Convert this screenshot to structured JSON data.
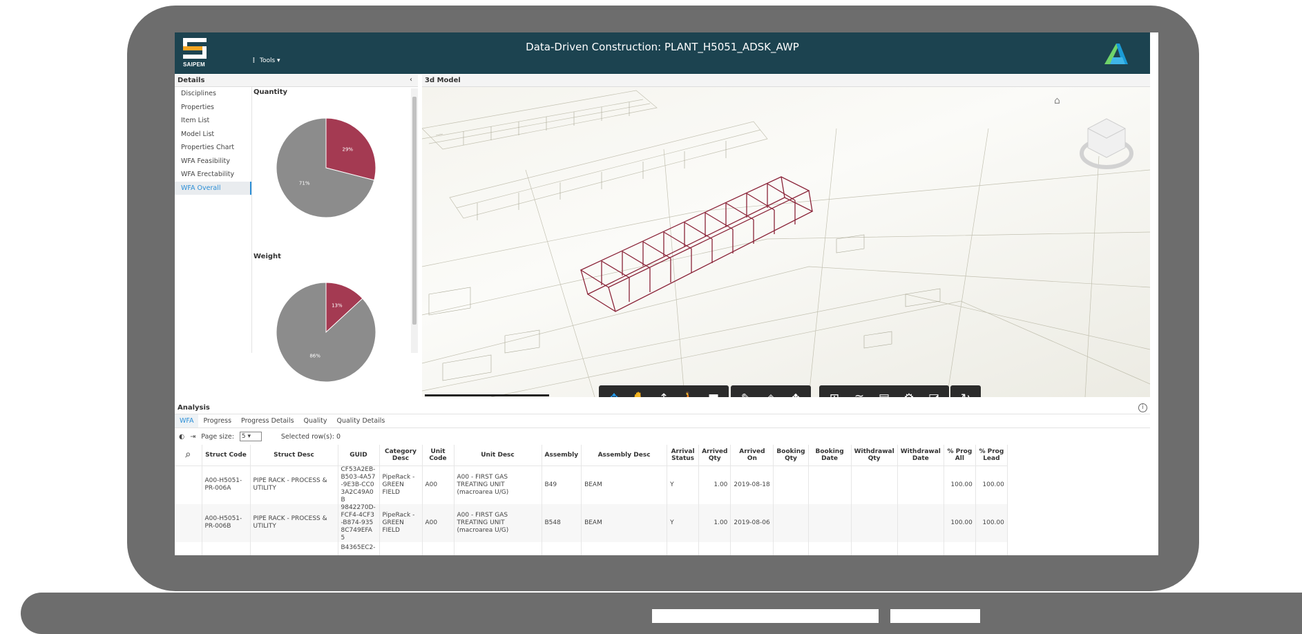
{
  "app": {
    "title": "Data-Driven Construction: PLANT_H5051_ADSK_AWP",
    "logo_text": "SAIPEM",
    "tools_label": "Tools",
    "colors": {
      "header": "#1c4350",
      "accent": "#2b8ed6",
      "highlight": "#9e2b44"
    }
  },
  "details": {
    "title": "Details",
    "collapse_icon": "chevron-left-icon",
    "nav": [
      {
        "label": "Disciplines"
      },
      {
        "label": "Properties"
      },
      {
        "label": "Item List"
      },
      {
        "label": "Model List"
      },
      {
        "label": "Properties Chart"
      },
      {
        "label": "WFA Feasibility"
      },
      {
        "label": "WFA Erectability"
      },
      {
        "label": "WFA Overall",
        "active": true
      }
    ]
  },
  "chart_data": [
    {
      "type": "pie",
      "title": "Quantity",
      "categories": [
        "",
        ""
      ],
      "values": [
        29,
        71
      ],
      "labels": [
        "29%",
        "71%"
      ],
      "colors": [
        "#a43a52",
        "#8c8c8c"
      ]
    },
    {
      "type": "pie",
      "title": "Weight",
      "categories": [
        "",
        ""
      ],
      "values": [
        13,
        86
      ],
      "labels": [
        "13%",
        "86%"
      ],
      "colors": [
        "#a43a52",
        "#8c8c8c"
      ]
    }
  ],
  "viewer": {
    "title": "3d Model",
    "home_icon": "home-icon",
    "toolbar_groups": [
      [
        "orbit-icon",
        "pan-icon",
        "zoom-icon",
        "walk-icon",
        "camera-icon"
      ],
      [
        "measure-icon",
        "section-icon",
        "explode-icon"
      ],
      [
        "model-browser-icon",
        "layers-icon",
        "properties-icon",
        "settings-icon",
        "fullscreen-icon"
      ],
      [
        "reset-icon"
      ]
    ]
  },
  "analysis": {
    "title": "Analysis",
    "tabs": [
      {
        "label": "WFA",
        "active": true
      },
      {
        "label": "Progress"
      },
      {
        "label": "Progress Details"
      },
      {
        "label": "Quality"
      },
      {
        "label": "Quality Details"
      }
    ],
    "page_size_label": "Page size:",
    "page_size_value": "5",
    "selected_rows": "Selected row(s): 0",
    "columns": [
      "Struct Code",
      "Struct Desc",
      "GUID",
      "Category Desc",
      "Unit Code",
      "Unit Desc",
      "Assembly",
      "Assembly Desc",
      "Arrival Status",
      "Arrived Qty",
      "Arrived On",
      "Booking Qty",
      "Booking Date",
      "Withdrawal Qty",
      "Withdrawal Date",
      "% Prog All",
      "% Prog Lead"
    ],
    "rows": [
      [
        "A00-H5051-PR-006A",
        "PIPE RACK - PROCESS & UTILITY",
        "CF53A2EB-B503-4A57-9E3B-CC03A2C49A0B",
        "PipeRack - GREEN FIELD",
        "A00",
        "A00 - FIRST GAS TREATING UNIT (macroarea U/G)",
        "B49",
        "BEAM",
        "Y",
        "1.00",
        "2019-08-18",
        "",
        "",
        "",
        "",
        "100.00",
        "100.00"
      ],
      [
        "A00-H5051-PR-006B",
        "PIPE RACK - PROCESS & UTILITY",
        "9842270D-FCF4-4CF3-B874-9358C749EFA5",
        "PipeRack - GREEN FIELD",
        "A00",
        "A00 - FIRST GAS TREATING UNIT (macroarea U/G)",
        "B548",
        "BEAM",
        "Y",
        "1.00",
        "2019-08-06",
        "",
        "",
        "",
        "",
        "100.00",
        "100.00"
      ],
      [
        "",
        "",
        "B4365EC2-",
        "",
        "",
        "",
        "",
        "",
        "",
        "",
        "",
        "",
        "",
        "",
        "",
        "",
        ""
      ]
    ]
  }
}
